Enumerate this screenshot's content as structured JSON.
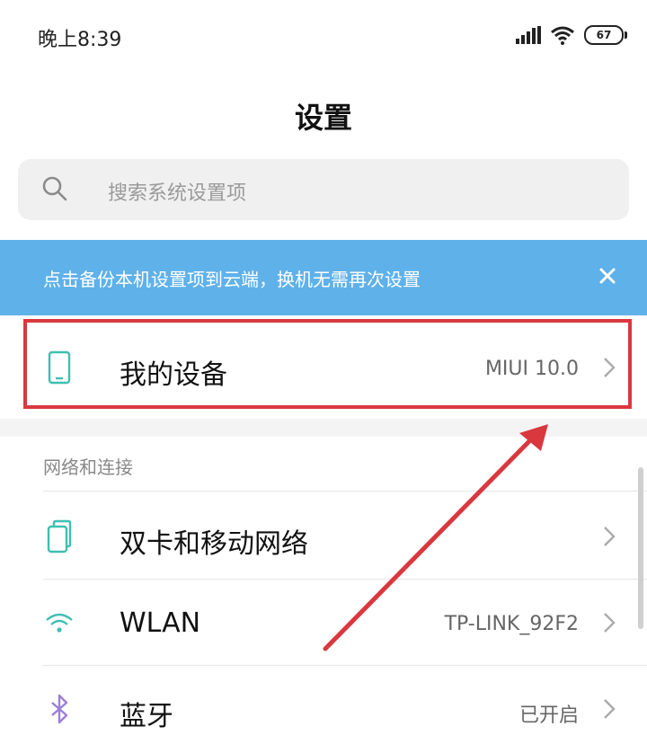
{
  "status_bar": {
    "time": "晚上8:39",
    "battery": "67",
    "icons": [
      "signal-icon",
      "wifi-icon",
      "battery-icon"
    ]
  },
  "header": {
    "title": "设置"
  },
  "search": {
    "placeholder": "搜索系统设置项"
  },
  "banner": {
    "text": "点击备份本机设置项到云端，换机无需再次设置"
  },
  "my_device": {
    "label": "我的设备",
    "value": "MIUI 10.0"
  },
  "section": {
    "header": "网络和连接"
  },
  "items": [
    {
      "label": "双卡和移动网络",
      "value": "",
      "icon": "sim-card-icon"
    },
    {
      "label": "WLAN",
      "value": "TP-LINK_92F2",
      "icon": "wifi-icon"
    },
    {
      "label": "蓝牙",
      "value": "已开启",
      "icon": "bluetooth-icon"
    }
  ],
  "colors": {
    "banner_bg": "#5fb1ea",
    "highlight": "#d9383e",
    "icon_accent": "#3fbfb0",
    "bluetooth_icon": "#9b7fd6"
  }
}
